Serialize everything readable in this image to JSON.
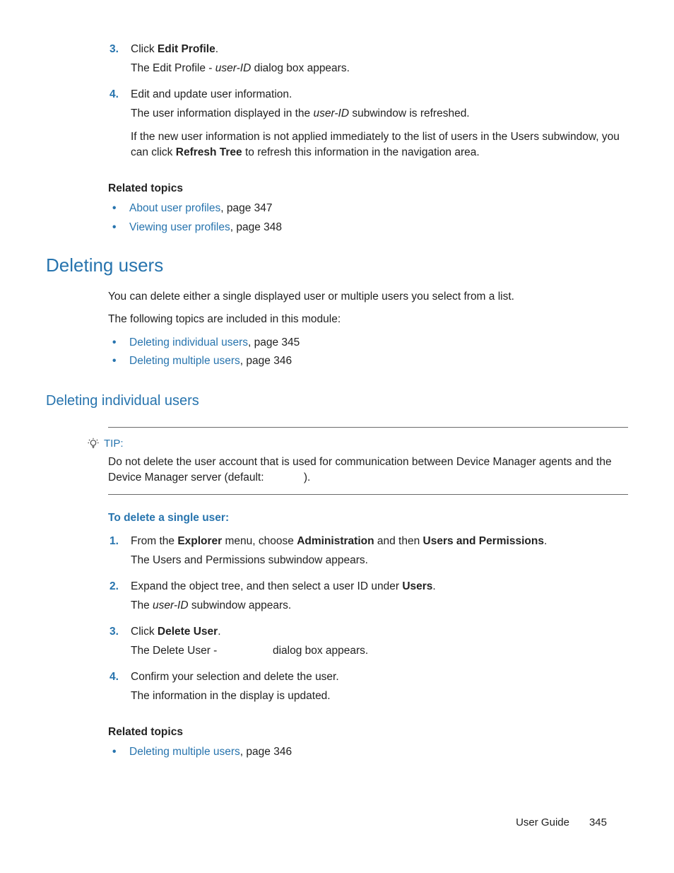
{
  "step3": {
    "num": "3.",
    "line1_pre": "Click ",
    "line1_bold": "Edit Profile",
    "line1_post": ".",
    "para_pre": "The Edit Profile - ",
    "para_italic": "user-ID",
    "para_post": " dialog box appears."
  },
  "step4": {
    "num": "4.",
    "line1": "Edit and update user information.",
    "para1_pre": "The user information displayed in the ",
    "para1_italic": "user-ID",
    "para1_post": " subwindow is refreshed.",
    "para2_pre": "If the new user information is not applied immediately to the list of users in the Users subwindow, you can click ",
    "para2_bold": "Refresh Tree",
    "para2_post": " to refresh this information in the navigation area."
  },
  "related1": {
    "heading": "Related topics",
    "item1_link": "About user profiles",
    "item1_tail": ", page 347",
    "item2_link": "Viewing user profiles",
    "item2_tail": ", page 348"
  },
  "heading_deleting_users": "Deleting users",
  "del_intro1": "You can delete either a single displayed user or multiple users you select from a list.",
  "del_intro2": "The following topics are included in this module:",
  "del_links": {
    "item1_link": "Deleting individual users",
    "item1_tail": ", page 345",
    "item2_link": "Deleting multiple users",
    "item2_tail": ", page 346"
  },
  "heading_deleting_individual": "Deleting individual users",
  "tip": {
    "label": "TIP:",
    "body_pre": "Do not delete the user account that is used for communication between Device Manager agents and the Device Manager server (default: ",
    "body_post": ")."
  },
  "procedure_heading": "To delete a single user:",
  "p1": {
    "num": "1.",
    "pre": "From the ",
    "b1": "Explorer",
    "mid1": " menu, choose ",
    "b2": "Administration",
    "mid2": " and then ",
    "b3": "Users and Permissions",
    "post": ".",
    "para": "The Users and Permissions subwindow appears."
  },
  "p2": {
    "num": "2.",
    "pre": "Expand the object tree, and then select a user ID under ",
    "b1": "Users",
    "post": ".",
    "para_pre": "The ",
    "para_italic": "user-ID",
    "para_post": " subwindow appears."
  },
  "p3": {
    "num": "3.",
    "pre": "Click ",
    "b1": "Delete User",
    "post": ".",
    "para_pre": "The Delete User - ",
    "para_post": " dialog box appears."
  },
  "p4": {
    "num": "4.",
    "line": "Confirm your selection and delete the user.",
    "para": "The information in the display is updated."
  },
  "related2": {
    "heading": "Related topics",
    "item1_link": "Deleting multiple users",
    "item1_tail": ", page 346"
  },
  "footer": {
    "label": "User Guide",
    "page": "345"
  },
  "bullet": "•"
}
